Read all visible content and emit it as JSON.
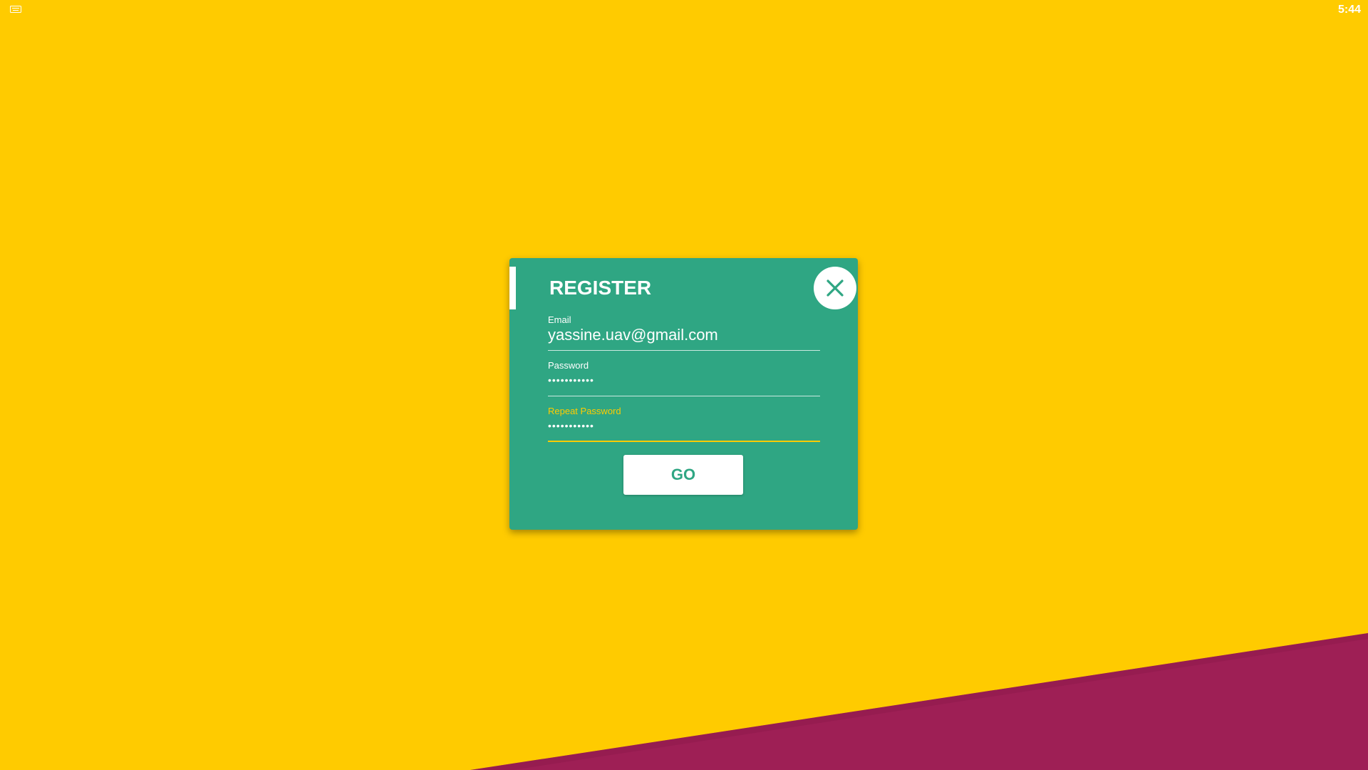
{
  "status_bar": {
    "keyboard_icon": "keyboard-icon",
    "time": "5:44"
  },
  "dialog": {
    "title": "REGISTER",
    "close_icon": "close-icon",
    "fields": [
      {
        "label": "Email",
        "value": "yassine.uav@gmail.com",
        "masked": false,
        "focused": false
      },
      {
        "label": "Password",
        "value": "•••••••••••",
        "masked": true,
        "focused": false
      },
      {
        "label": "Repeat Password",
        "value": "•••••••••••",
        "masked": true,
        "focused": true
      }
    ],
    "submit_label": "GO"
  },
  "colors": {
    "background": "#FFCB00",
    "accent_shape": "#9E1F55",
    "dialog": "#2FA683",
    "focus": "#FFCB00",
    "text": "#FFFFFF"
  }
}
